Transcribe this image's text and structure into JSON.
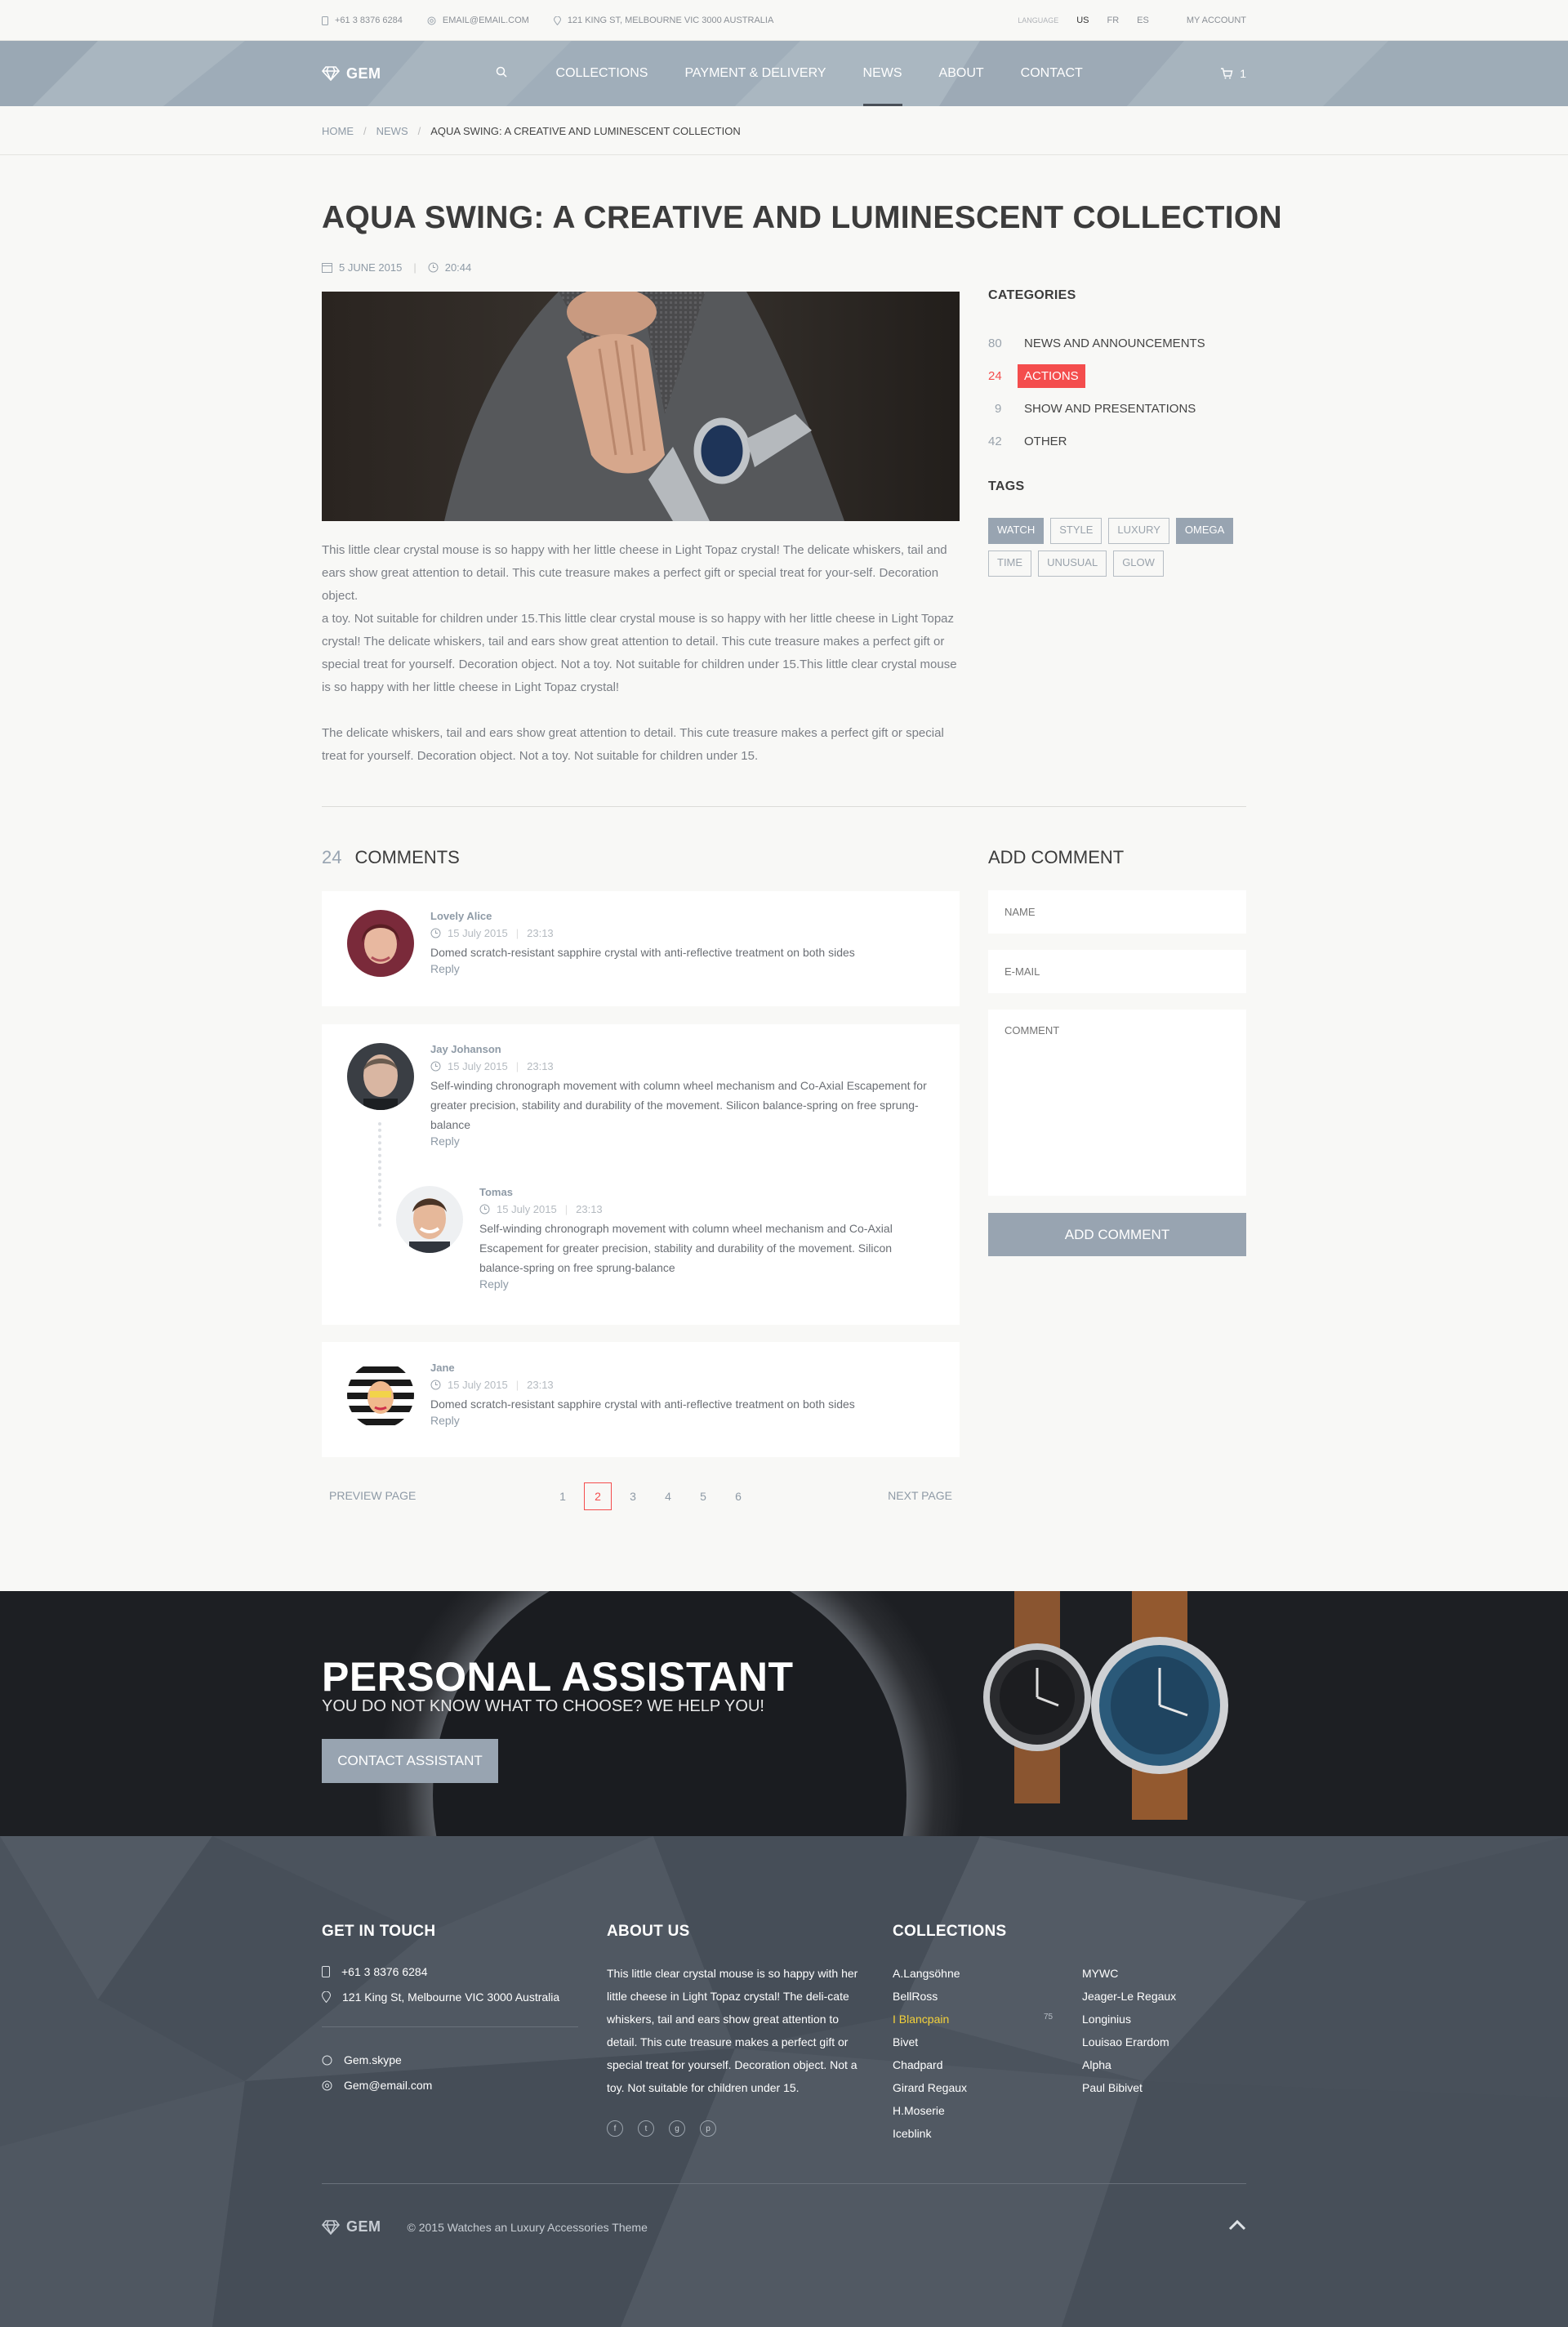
{
  "topbar": {
    "phone": "+61 3 8376 6284",
    "email": "EMAIL@EMAIL.COM",
    "address": "121 KING ST, MELBOURNE VIC 3000 AUSTRALIA",
    "language_label": "LANGUAGE",
    "languages": [
      "US",
      "FR",
      "ES"
    ],
    "active_language": "US",
    "account": "MY ACCOUNT"
  },
  "header": {
    "logo": "GEM",
    "nav": [
      "COLLECTIONS",
      "PAYMENT & DELIVERY",
      "NEWS",
      "ABOUT",
      "CONTACT"
    ],
    "active_nav": "NEWS",
    "cart_count": "1"
  },
  "breadcrumb": {
    "home": "HOME",
    "news": "NEWS",
    "current": "AQUA SWING: A CREATIVE AND LUMINESCENT COLLECTION"
  },
  "post": {
    "title": "AQUA SWING: A CREATIVE AND LUMINESCENT COLLECTION",
    "date": "5 JUNE 2015",
    "time": "20:44",
    "para1": "This little clear crystal mouse is so happy with her little cheese in Light Topaz crystal! The delicate whiskers, tail and ears show great attention to detail. This cute treasure makes a perfect gift or special treat for your-self. Decoration object.",
    "para2": "a toy. Not suitable for children under 15.This little clear crystal mouse is so happy with her little cheese in Light Topaz crystal! The delicate whiskers, tail and ears show great attention to detail. This cute treasure makes a perfect gift or special treat for yourself. Decoration object. Not a toy. Not suitable for children under 15.This little clear crystal mouse is so happy with her little cheese in Light Topaz crystal!",
    "para3": "The delicate whiskers, tail and ears show great attention to detail. This cute treasure makes a perfect gift or special treat for yourself. Decoration object. Not a toy. Not suitable for children under 15."
  },
  "sidebar": {
    "categories_title": "CATEGORIES",
    "categories": [
      {
        "count": "80",
        "label": "NEWS AND ANNOUNCEMENTS"
      },
      {
        "count": "24",
        "label": "ACTIONS"
      },
      {
        "count": "9",
        "label": "SHOW AND PRESENTATIONS"
      },
      {
        "count": "42",
        "label": "OTHER"
      }
    ],
    "active_category": "ACTIONS",
    "tags_title": "TAGS",
    "tags": [
      "WATCH",
      "STYLE",
      "LUXURY",
      "OMEGA",
      "TIME",
      "UNUSUAL",
      "GLOW"
    ],
    "active_tags": [
      "WATCH",
      "OMEGA"
    ]
  },
  "comments": {
    "count": "24",
    "title": "COMMENTS",
    "items": [
      {
        "name": "Lovely Alice",
        "date": "15 July 2015",
        "time": "23:13",
        "text": "Domed scratch-resistant sapphire crystal with anti-reflective treatment on both sides",
        "reply": "Reply"
      },
      {
        "name": "Jay Johanson",
        "date": "15 July 2015",
        "time": "23:13",
        "text": "Self-winding chronograph movement with column wheel mechanism and Co-Axial Escapement for greater precision, stability and durability of the movement. Silicon balance-spring on free sprung-balance",
        "reply": "Reply"
      },
      {
        "name": "Tomas",
        "date": "15 July 2015",
        "time": "23:13",
        "text": "Self-winding chronograph movement with column wheel mechanism and Co-Axial Escapement for greater precision, stability and durability of the movement. Silicon balance-spring on free sprung-balance",
        "reply": "Reply"
      },
      {
        "name": "Jane",
        "date": "15 July 2015",
        "time": "23:13",
        "text": "Domed scratch-resistant sapphire crystal with anti-reflective treatment on both sides",
        "reply": "Reply"
      }
    ]
  },
  "form": {
    "title": "ADD COMMENT",
    "name_placeholder": "NAME",
    "email_placeholder": "E-MAIL",
    "comment_placeholder": "COMMENT",
    "submit": "ADD COMMENT"
  },
  "pager": {
    "prev": "PREVIEW PAGE",
    "next": "NEXT PAGE",
    "pages": [
      "1",
      "2",
      "3",
      "4",
      "5",
      "6"
    ],
    "current": "2"
  },
  "assistant": {
    "title": "PERSONAL ASSISTANT",
    "subtitle": "YOU DO NOT KNOW WHAT TO CHOOSE? WE HELP YOU!",
    "button": "CONTACT ASSISTANT"
  },
  "footer": {
    "touch_title": "GET IN TOUCH",
    "phone": "+61 3 8376 6284",
    "address": "121 King St, Melbourne VIC 3000 Australia",
    "skype": "Gem.skype",
    "email": "Gem@email.com",
    "about_title": "ABOUT US",
    "about_text": "This little clear crystal mouse is so happy with her little cheese in Light Topaz crystal! The deli-cate whiskers, tail and ears show great attention to detail. This cute treasure makes a perfect gift or special treat for yourself. Decoration object. Not a toy. Not suitable for children under 15.",
    "collections_title": "COLLECTIONS",
    "collections_col1": [
      "A.Langsöhne",
      "BellRoss",
      "Blancpain",
      "Bivet",
      "Chadpard",
      "Girard Regaux",
      "H.Moserie",
      "Iceblink"
    ],
    "collections_col2": [
      "MYWC",
      "Jeager-Le Regaux",
      "Longinius",
      "Louisao Erardom",
      "Alpha",
      "Paul Bibivet"
    ],
    "highlighted": "Blancpain",
    "highlighted_count": "75",
    "logo": "GEM",
    "copyright": "© 2015 Watches an Luxury Accessories Theme",
    "colors": {
      "accent_red": "#f44d4d",
      "highlight_yellow": "#f3d13a",
      "button_gray": "#98a4b1"
    }
  }
}
